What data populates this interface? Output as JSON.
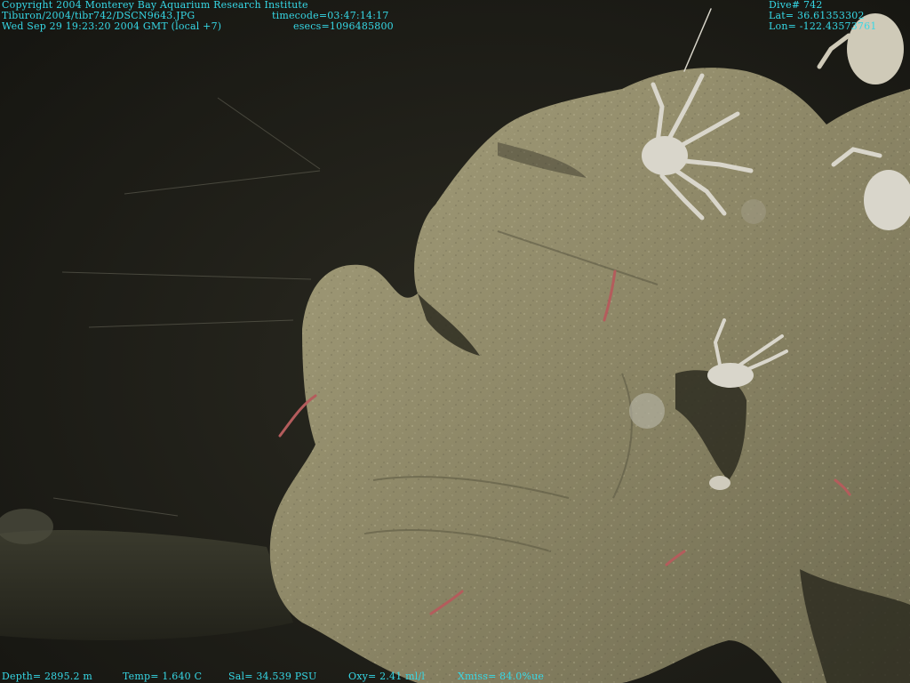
{
  "overlay": {
    "copyright": "Copyright 2004 Monterey Bay Aquarium Research Institute",
    "file_path": "Tiburon/2004/tibr742/DSCN9643.JPG",
    "timecode": "timecode=03:47:14:17",
    "datetime": "Wed Sep 29 19:23:20 2004 GMT (local +7)",
    "esecs": "esecs=1096485800",
    "dive": "Dive# 742",
    "lat": "Lat= 36.61353302",
    "lon": "Lon= -122.43573761",
    "depth": "Depth= 2895.2 m",
    "temp": "Temp= 1.640 C",
    "sal": "Sal= 34.539 PSU",
    "oxy": "Oxy= 2.41 ml/l",
    "xmiss": "Xmiss= 84.0%ue"
  },
  "colors": {
    "overlay_text": "#36d8e6",
    "seafloor": "#1c1b16",
    "rock": "#8f8a6a",
    "crab": "#d9d6cb"
  }
}
